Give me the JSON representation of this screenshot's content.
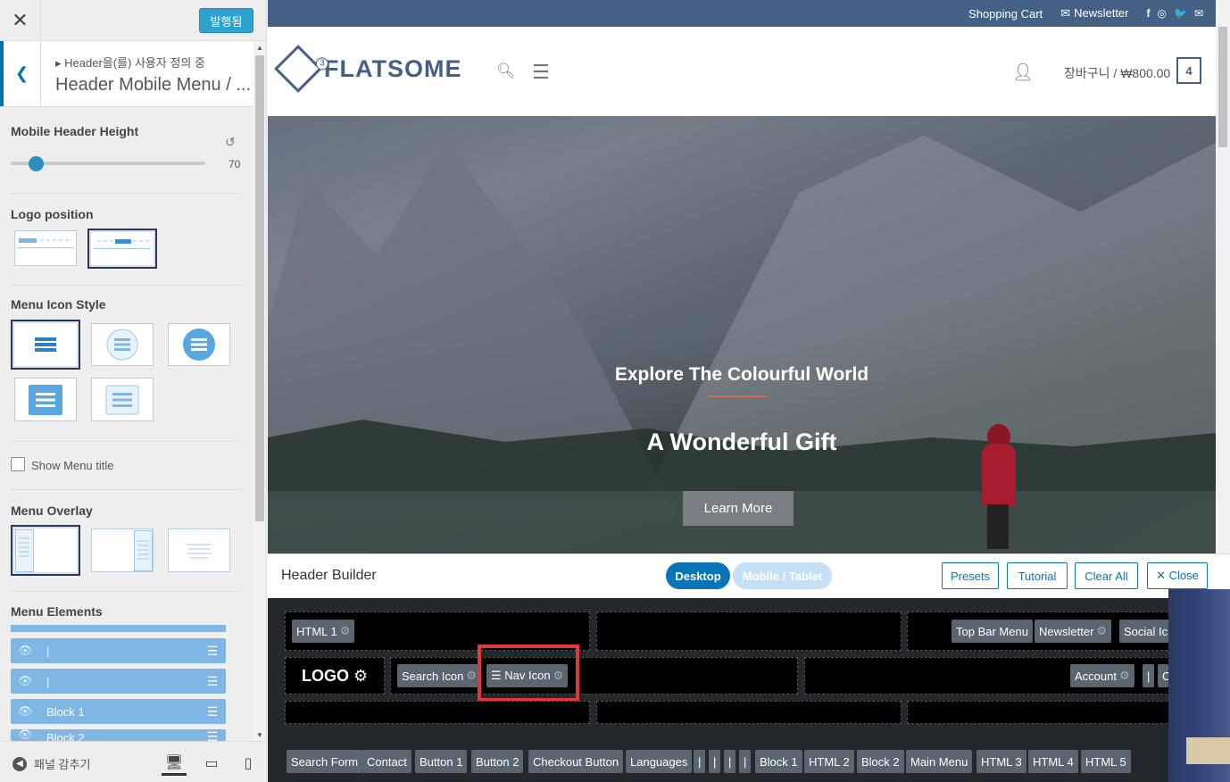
{
  "customizer": {
    "publish_label": "발행됨",
    "breadcrumb_sub": "▸ Header을(를) 사용자 정의 중",
    "breadcrumb_title": "Header Mobile Menu / ...",
    "mobile_header_height_label": "Mobile Header Height",
    "mobile_header_height_value": "70",
    "mobile_header_height_fraction": 0.13,
    "logo_position_label": "Logo position",
    "menu_icon_style_label": "Menu Icon Style",
    "show_menu_title_label": "Show Menu title",
    "show_menu_title_checked": false,
    "menu_overlay_label": "Menu Overlay",
    "menu_elements_label": "Menu Elements",
    "menu_elements": [
      {
        "label": "|"
      },
      {
        "label": "|"
      },
      {
        "label": "Block 1"
      },
      {
        "label": "Block 2"
      }
    ],
    "hide_panel_label": "패널 감추기"
  },
  "site": {
    "topbar": {
      "shopping_cart": "Shopping Cart",
      "newsletter": "Newsletter",
      "social_icons": [
        "f",
        "◎",
        "🐦",
        "✉"
      ]
    },
    "logo_text": "FLATSOME",
    "logo_badge": "3",
    "cart_label": "장바구니 / ₩800.00",
    "cart_count": "4",
    "hero": {
      "title": "Explore The Colourful World",
      "subtitle": "A Wonderful Gift",
      "button": "Learn More"
    }
  },
  "header_builder": {
    "title": "Header Builder",
    "tab_desktop": "Desktop",
    "tab_mobile": "Mobile / Tablet",
    "presets": "Presets",
    "tutorial": "Tutorial",
    "clear_all": "Clear All",
    "close": "✕ Close",
    "row1_left": [
      "HTML 1"
    ],
    "row1_right": [
      "Top Bar Menu",
      "Newsletter",
      "Social Ic"
    ],
    "logo_label": "LOGO",
    "row2_left": [
      "Search Icon",
      "☰ Nav Icon"
    ],
    "row2_right": [
      "Account",
      "|",
      "C"
    ],
    "available_elements": [
      "Search Form",
      "Contact",
      "Button 1",
      "Button 2",
      "Checkout Button",
      "Languages",
      "|",
      "|",
      "|",
      "|",
      "Block 1",
      "HTML 2",
      "Block 2",
      "Main Menu",
      "HTML 3",
      "HTML 4",
      "HTML 5"
    ]
  }
}
